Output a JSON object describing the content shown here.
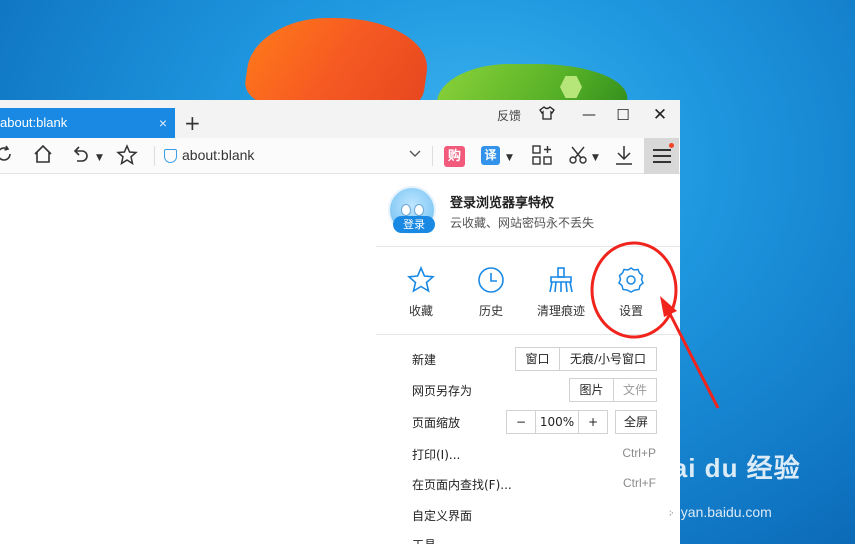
{
  "tab": {
    "title": "about:blank",
    "close": "×",
    "new_tab": "+"
  },
  "window": {
    "feedback": "反馈",
    "minimize": "—",
    "maximize": "☐",
    "close": "✕"
  },
  "toolbar": {
    "address": "about:blank",
    "gou": "购",
    "yi": "译"
  },
  "menu": {
    "login": {
      "badge": "登录",
      "title": "登录浏览器享特权",
      "subtitle": "云收藏、网站密码永不丢失"
    },
    "quick_actions": [
      {
        "label": "收藏",
        "icon": "star-icon"
      },
      {
        "label": "历史",
        "icon": "clock-icon"
      },
      {
        "label": "清理痕迹",
        "icon": "broom-icon"
      },
      {
        "label": "设置",
        "icon": "gear-icon"
      }
    ],
    "new": {
      "label": "新建",
      "window": "窗口",
      "incognito": "无痕/小号窗口"
    },
    "save_as": {
      "label": "网页另存为",
      "image": "图片",
      "file": "文件"
    },
    "zoom": {
      "label": "页面缩放",
      "minus": "−",
      "value": "100%",
      "plus": "+",
      "fullscreen": "全屏"
    },
    "print": {
      "label": "打印(I)...",
      "shortcut": "Ctrl+P"
    },
    "find": {
      "label": "在页面内查找(F)...",
      "shortcut": "Ctrl+F"
    },
    "customize": {
      "label": "自定义界面"
    },
    "tools": {
      "label": "工具"
    }
  },
  "watermark": {
    "logo": "Bai du 经验",
    "url": "jingyan.baidu.com"
  },
  "colors": {
    "accent": "#1a89e4",
    "annotation": "#f0241c",
    "desktop": "#1f98e0"
  }
}
